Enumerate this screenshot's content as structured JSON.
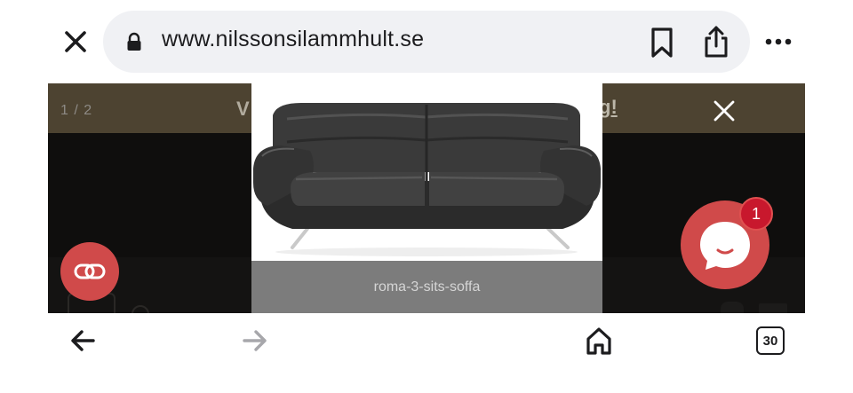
{
  "browser": {
    "url": "www.nilssonsilammhult.se",
    "tab_count": "30"
  },
  "lightbox": {
    "counter": "1 / 2",
    "caption": "roma-3-sits-soffa"
  },
  "page": {
    "banner_left_text": "V",
    "banner_right_text": "g!"
  },
  "chat": {
    "badge_count": "1"
  },
  "colors": {
    "accent_red": "#d04a4a",
    "badge_red": "#c8182d",
    "banner_brown": "#4d4331"
  },
  "icons": {
    "close": "close-icon",
    "lock": "lock-icon",
    "bookmark": "bookmark-icon",
    "share": "share-icon",
    "more": "more-icon",
    "lightbox_close": "close-icon",
    "link": "link-icon",
    "chat": "chat-bubble-icon",
    "back": "arrow-left-icon",
    "forward": "arrow-right-icon",
    "home": "home-icon"
  }
}
